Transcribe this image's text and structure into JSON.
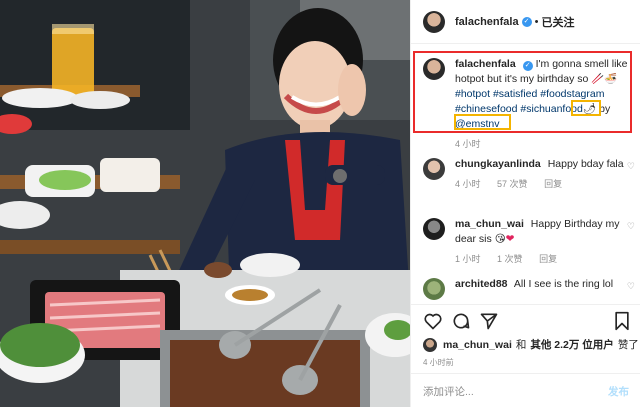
{
  "header": {
    "username": "falachenfala",
    "verified_icon": "✓",
    "separator": "•",
    "follow_status": "已关注"
  },
  "caption": {
    "username": "falachenfala",
    "text_before": "I'm gonna smell like hotpot but it's my birthday so",
    "hashtags": [
      "#hotpot",
      "#satisfied",
      "#foodstagram",
      "#chinesefood",
      "#sichuanfood"
    ],
    "by": "by",
    "mention": "@emstnv",
    "time": "4 小时"
  },
  "comments": [
    {
      "username": "chungkayanlinda",
      "text": "Happy bday fala",
      "time": "4 小时",
      "likes": "57 次赞",
      "reply": "回复"
    },
    {
      "username": "ma_chun_wai",
      "text": "Happy Birthday my dear sis",
      "time": "1 小时",
      "likes": "1 次赞",
      "reply": "回复"
    },
    {
      "username": "archited88",
      "text": "All I see is the ring lol",
      "time": "",
      "likes": "",
      "reply": ""
    }
  ],
  "likes": {
    "first_user": "ma_chun_wai",
    "conjunction": "和",
    "others": "其他 2.2万 位用户",
    "suffix": "赞了"
  },
  "post_time": "4 小时前",
  "comment_box": {
    "placeholder": "添加评论...",
    "post_label": "发布"
  },
  "colors": {
    "highlight_red": "#ea2b2b",
    "highlight_yellow": "#f4b400",
    "link": "#00376b",
    "muted": "#8e8e8e",
    "verified": "#3897f0"
  },
  "icons": [
    "verified-badge-icon",
    "heart-icon",
    "comment-icon",
    "share-icon",
    "bookmark-icon"
  ]
}
